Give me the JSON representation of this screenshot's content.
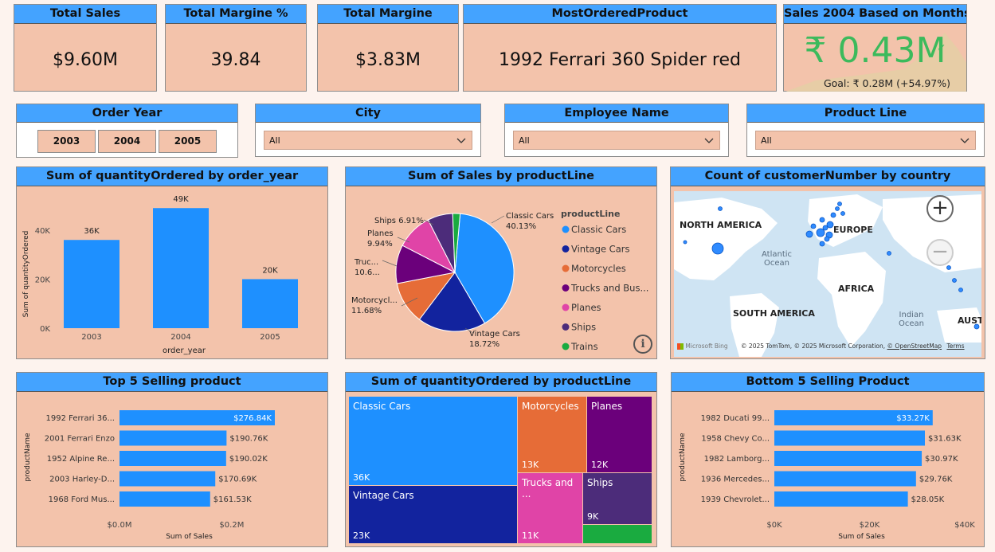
{
  "kpis": [
    {
      "title": "Total Sales",
      "value": "$9.60M"
    },
    {
      "title": "Total Margine %",
      "value": "39.84"
    },
    {
      "title": "Total Margine",
      "value": "$3.83M"
    },
    {
      "title": "MostOrderedProduct",
      "value": "1992 Ferrari 360 Spider red"
    }
  ],
  "goal_card": {
    "title": "Sales 2004 Based on Months",
    "value": "₹ 0.43M",
    "goal": "Goal: ₹ 0.28M (+54.97%)",
    "value_color": "#3cba5c"
  },
  "slicers": {
    "order_year": {
      "title": "Order Year",
      "options": [
        "2003",
        "2004",
        "2005"
      ]
    },
    "city": {
      "title": "City",
      "value": "All"
    },
    "employee": {
      "title": "Employee Name",
      "value": "All"
    },
    "product_line": {
      "title": "Product Line",
      "value": "All"
    }
  },
  "colors": {
    "header": "#44a3ff",
    "panel": "#f3c3ab",
    "bar": "#1e90ff"
  },
  "charts": {
    "qty_by_year": {
      "title": "Sum of quantityOrdered by order_year"
    },
    "sales_by_line": {
      "title": "Sum of Sales by productLine",
      "legend_title": "productLine"
    },
    "map": {
      "title": "Count of customerNumber by country",
      "labels": {
        "na": "NORTH AMERICA",
        "eu": "EUROPE",
        "atl": "Atlantic\nOcean",
        "af": "AFRICA",
        "sa": "SOUTH AMERICA",
        "ind": "Indian\nOcean",
        "aus": "AUST"
      },
      "bing": "Microsoft Bing",
      "copyright": "© 2025 TomTom, © 2025 Microsoft Corporation,",
      "osm": "© OpenStreetMap",
      "terms": "Terms"
    },
    "top5": {
      "title": "Top 5 Selling product"
    },
    "treemap": {
      "title": "Sum of quantityOrdered by productLine"
    },
    "bottom5": {
      "title": "Bottom 5 Selling Product"
    }
  },
  "chart_data": [
    {
      "type": "bar",
      "title": "Sum of quantityOrdered by order_year",
      "categories": [
        "2003",
        "2004",
        "2005"
      ],
      "values": [
        36,
        49,
        20
      ],
      "data_labels": [
        "36K",
        "49K",
        "20K"
      ],
      "xlabel": "order_year",
      "ylabel": "Sum of quantityOrdered",
      "yticks": [
        "0K",
        "20K",
        "40K"
      ],
      "ylim": [
        0,
        52
      ]
    },
    {
      "type": "pie",
      "title": "Sum of Sales by productLine",
      "legend_title": "productLine",
      "legend": [
        "Classic Cars",
        "Vintage Cars",
        "Motorcycles",
        "Trucks and Bus...",
        "Planes",
        "Ships",
        "Trains"
      ],
      "slices": [
        {
          "name": "Classic Cars",
          "value": 40.13,
          "label": "Classic Cars",
          "pct": "40.13%",
          "color": "#1e90ff"
        },
        {
          "name": "Vintage Cars",
          "value": 18.72,
          "label": "Vintage Cars",
          "pct": "18.72%",
          "color": "#12239e"
        },
        {
          "name": "Motorcycles",
          "value": 11.68,
          "label": "Motorcycl...",
          "pct": "11.68%",
          "color": "#e66c37"
        },
        {
          "name": "Trucks and Buses",
          "value": 10.6,
          "label": "Truc...",
          "pct": "10.6...",
          "color": "#6b007b"
        },
        {
          "name": "Planes",
          "value": 9.94,
          "label": "Planes",
          "pct": "9.94%",
          "color": "#e044a7"
        },
        {
          "name": "Ships",
          "value": 6.91,
          "label": "Ships 6.91%",
          "pct": "",
          "color": "#4c2c7a"
        },
        {
          "name": "Trains",
          "value": 2.02,
          "label": "",
          "pct": "",
          "color": "#1aab40"
        }
      ]
    },
    {
      "type": "bar",
      "title": "Top 5 Selling product",
      "orientation": "horizontal",
      "categories": [
        "1992 Ferrari 36...",
        "2001 Ferrari Enzo",
        "1952 Alpine Re...",
        "2003 Harley-D...",
        "1968 Ford Mus..."
      ],
      "values": [
        276.84,
        190.76,
        190.02,
        170.69,
        161.53
      ],
      "data_labels": [
        "$276.84K",
        "$190.76K",
        "$190.02K",
        "$170.69K",
        "$161.53K"
      ],
      "xlabel": "Sum of Sales",
      "ylabel": "productName",
      "xticks": [
        "$0.0M",
        "$0.2M"
      ],
      "xlim": [
        0,
        0.2
      ]
    },
    {
      "type": "treemap",
      "title": "Sum of quantityOrdered by productLine",
      "items": [
        {
          "name": "Classic Cars",
          "value": "36K"
        },
        {
          "name": "Vintage Cars",
          "value": "23K"
        },
        {
          "name": "Motorcycles",
          "value": "13K"
        },
        {
          "name": "Planes",
          "value": "12K"
        },
        {
          "name": "Trucks and ...",
          "value": "11K"
        },
        {
          "name": "Ships",
          "value": "9K"
        },
        {
          "name": "",
          "value": ""
        }
      ]
    },
    {
      "type": "bar",
      "title": "Bottom 5 Selling Product",
      "orientation": "horizontal",
      "categories": [
        "1982 Ducati 99...",
        "1958 Chevy Co...",
        "1982 Lamborg...",
        "1936 Mercedes...",
        "1939 Chevrolet..."
      ],
      "values": [
        33.27,
        31.63,
        30.97,
        29.76,
        28.05
      ],
      "data_labels": [
        "$33.27K",
        "$31.63K",
        "$30.97K",
        "$29.76K",
        "$28.05K"
      ],
      "xlabel": "Sum of Sales",
      "ylabel": "productName",
      "xticks": [
        "$0K",
        "$20K",
        "$40K"
      ],
      "xlim": [
        0,
        40
      ]
    }
  ]
}
